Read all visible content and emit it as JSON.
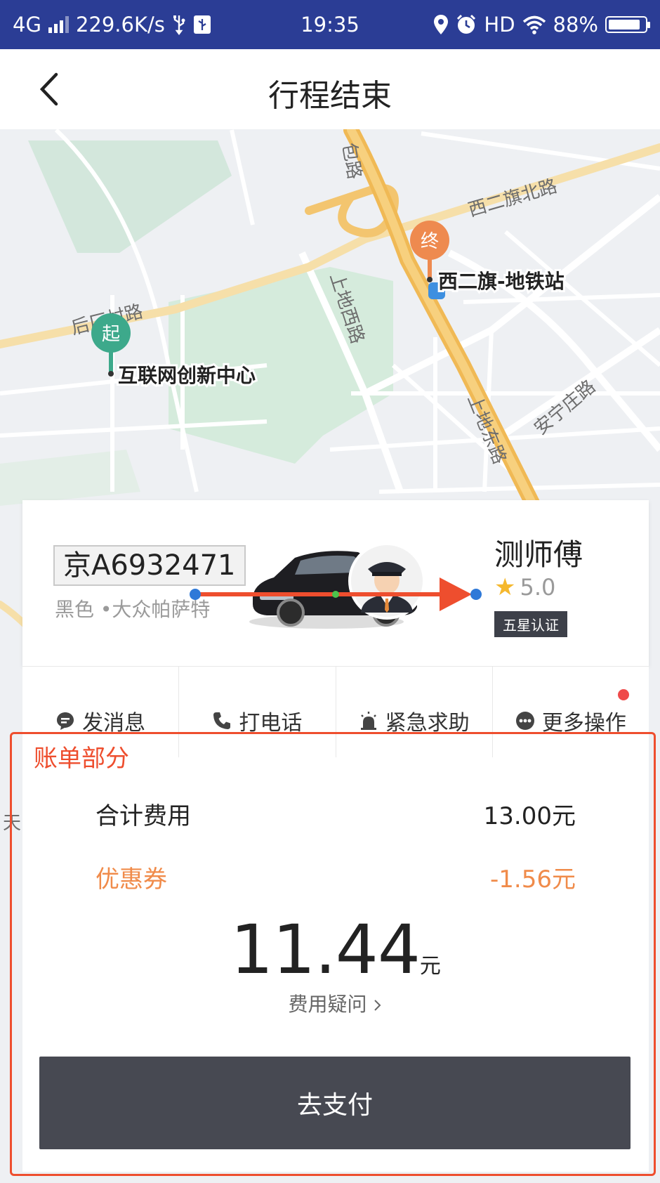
{
  "status_bar": {
    "network": "4G",
    "speed": "229.6K/s",
    "time": "19:35",
    "hd": "HD",
    "battery": "88%",
    "battery_level": 0.88,
    "icons": [
      "signal-icon",
      "usb-icon",
      "usb-debug-icon",
      "location-icon",
      "alarm-icon",
      "wifi-icon",
      "battery-icon"
    ]
  },
  "header": {
    "title": "行程结束",
    "back_icon": "chevron-left-icon"
  },
  "map": {
    "roads": [
      "包路",
      "西二旗北路",
      "上地西路",
      "后厂村路",
      "上地东路",
      "安宁庄路"
    ],
    "start_marker": "起",
    "start_label": "互联网创新中心",
    "end_marker": "终",
    "end_label": "西二旗-地铁站",
    "edge_text": "天"
  },
  "driver": {
    "plate": "京A6932471",
    "car_desc": "黑色 •大众帕萨特",
    "name": "测师傅",
    "rating": "5.0",
    "badge": "五星认证"
  },
  "actions": [
    {
      "label": "发消息",
      "icon": "message-icon"
    },
    {
      "label": "打电话",
      "icon": "phone-icon"
    },
    {
      "label": "紧急求助",
      "icon": "alarm-light-icon"
    },
    {
      "label": "更多操作",
      "icon": "more-icon"
    }
  ],
  "bill": {
    "total_label": "合计费用",
    "total_value": "13.00元",
    "coupon_label": "优惠券",
    "coupon_value": "-1.56元",
    "amount": "11.44",
    "unit": "元",
    "question": "费用疑问",
    "pay_button": "去支付"
  },
  "annotation": {
    "label": "账单部分"
  },
  "colors": {
    "status_bar": "#2b3d95",
    "start_pin": "#3da98b",
    "end_pin": "#ee8a4f",
    "coupon": "#f08b4a",
    "annotation": "#ee4e2e",
    "pay_button": "#474952"
  }
}
